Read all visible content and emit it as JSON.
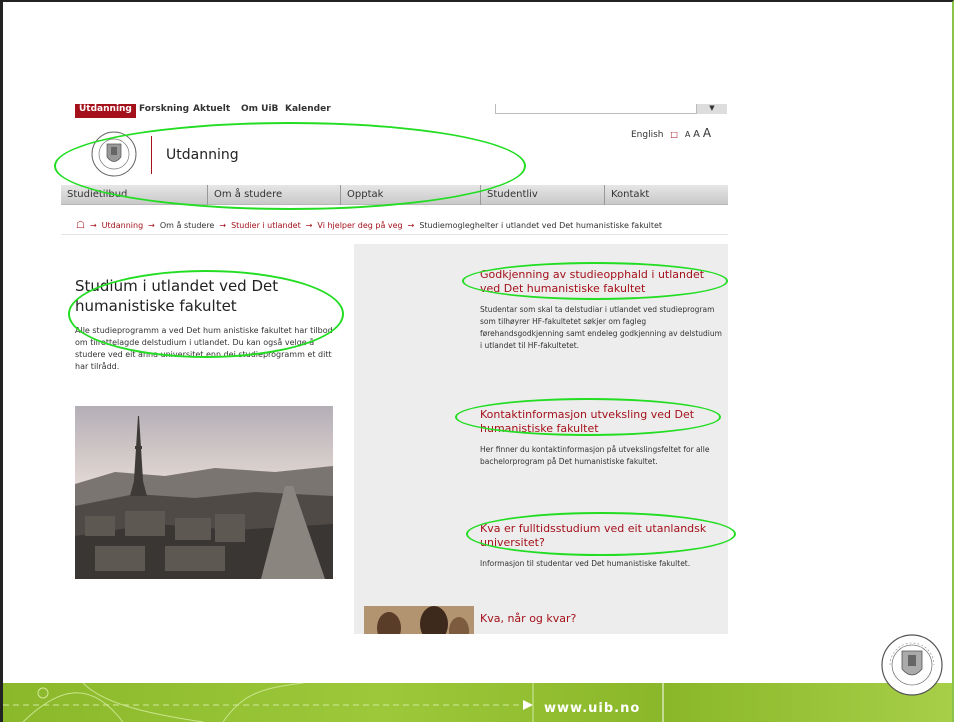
{
  "topnav": {
    "items": [
      "Utdanning",
      "Forskning",
      "Aktuelt",
      "Om UiB",
      "Kalender"
    ]
  },
  "search": {
    "button_label": "▼"
  },
  "lang": {
    "english": "English",
    "sep": "□",
    "a1": "A",
    "a2": "A",
    "a3": "A"
  },
  "header": {
    "title": "Utdanning"
  },
  "mainnav": {
    "tabs": [
      "Studietilbud",
      "Om å studere",
      "Opptak",
      "Studentliv",
      "Kontakt"
    ]
  },
  "breadcrumb": {
    "home_icon": "home-icon",
    "items": [
      "Utdanning",
      "Om å studere",
      "Studier i utlandet",
      "Vi hjelper deg på veg"
    ],
    "current": "Studiemogleghelter i utlandet ved Det humanistiske fakultet"
  },
  "main": {
    "title": "Studium i utlandet ved Det humanistiske fakultet",
    "intro": "Alle studieprogramm a ved Det hum anistiske fakultet har tilbod om tilrettelagde delstudium i utlandet. Du kan også velge å studere ved eit anna universitet enn dei studieprogramm et ditt har tilrådd."
  },
  "blocks": [
    {
      "head": "Godkjenning av studieopphald i utlandet ved Det humanistiske fakultet",
      "text": "Studentar som skal ta delstudiar i utlandet ved studieprogram som tilhøyrer HF-fakultetet søkjer om fagleg førehandsgodkjenning samt endeleg godkjenning av delstudium i utlandet til HF-fakultetet."
    },
    {
      "head": "Kontaktinformasjon utveksling ved Det humanistiske fakultet",
      "text": "Her finner du kontaktinformasjon på utvekslingsfeltet for alle bachelorprogram på Det humanistiske fakultet."
    },
    {
      "head": "Kva er fulltidsstudium ved eit utanlandsk universitet?",
      "text": "Informasjon til studentar ved Det humanistiske fakultet."
    },
    {
      "head": "Kva, når og kvar?",
      "text": ""
    }
  ],
  "footer": {
    "url": "www.uib.no"
  },
  "colors": {
    "brand_red": "#a4111b",
    "highlight_green": "#22dd22",
    "bar_green": "#8bb82b"
  }
}
